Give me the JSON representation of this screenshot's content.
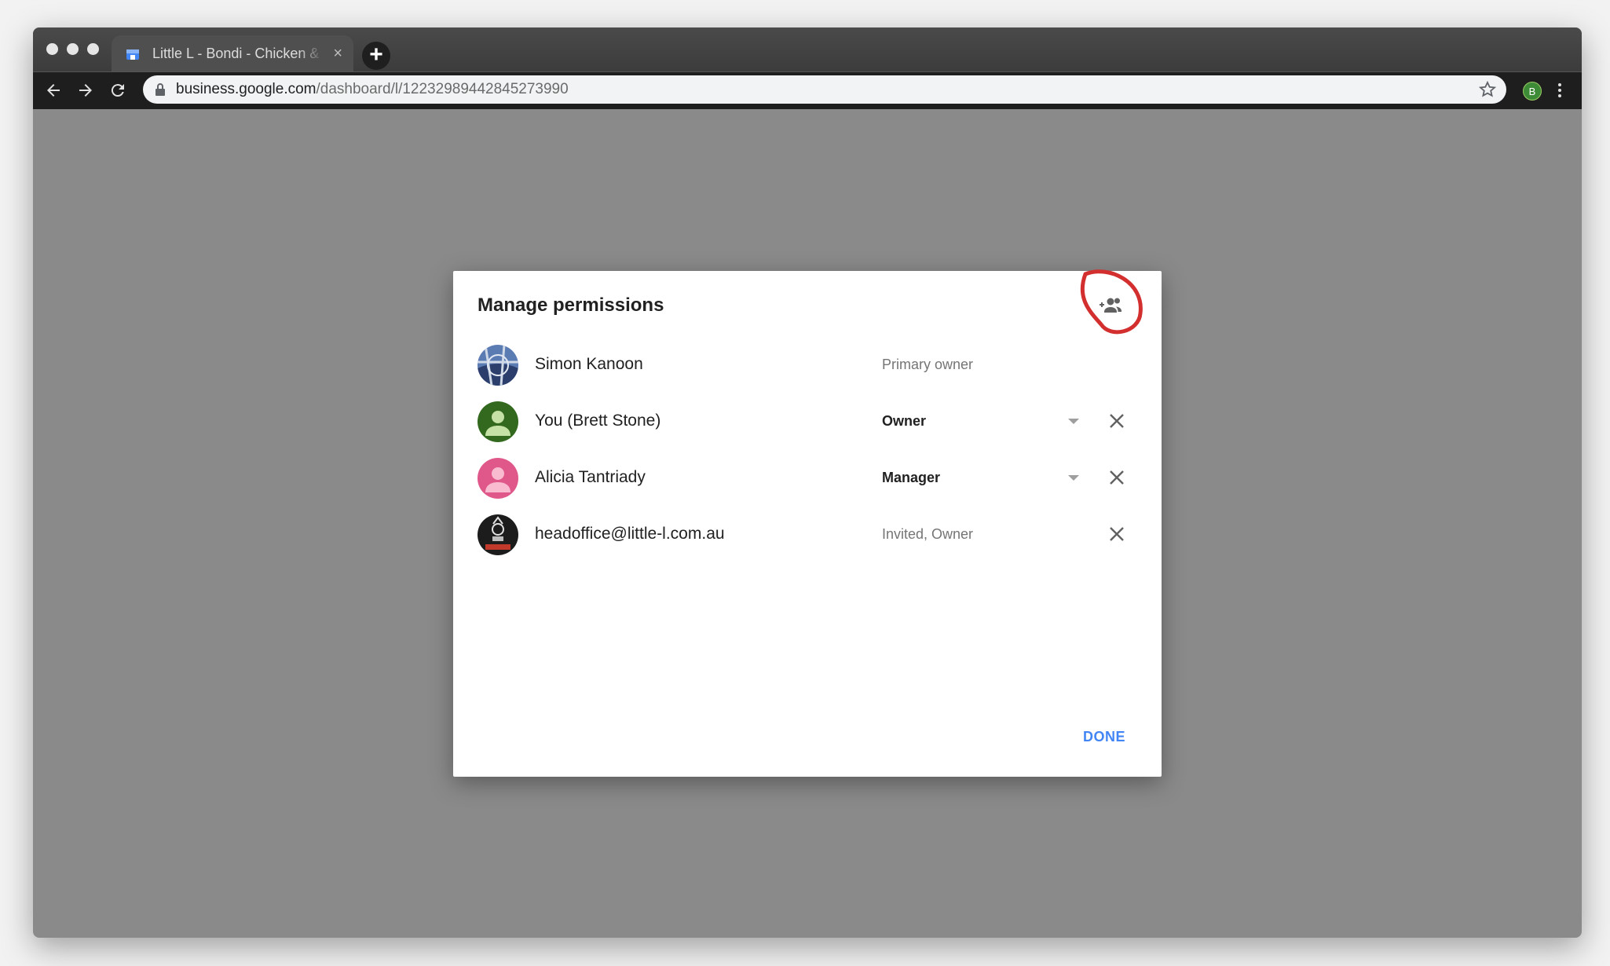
{
  "browser": {
    "tab_title": "Little L - Bondi - Chicken & Burgers",
    "tab_close": "×",
    "new_tab": "+",
    "url_host": "business.google.com",
    "url_path": "/dashboard/l/12232989442845273990",
    "profile_initial": "B",
    "accent_profile": "#3d8b37"
  },
  "dialog": {
    "title": "Manage permissions",
    "add_icon": "person-add-icon",
    "done_label": "DONE",
    "annotation_color": "#d32f2f",
    "users": [
      {
        "name": "Simon Kanoon",
        "role": "Primary owner",
        "editable": false,
        "removable": false
      },
      {
        "name": "You (Brett Stone)",
        "role": "Owner",
        "editable": true,
        "removable": true
      },
      {
        "name": "Alicia Tantriady",
        "role": "Manager",
        "editable": true,
        "removable": true
      },
      {
        "name": "headoffice@little-l.com.au",
        "role": "Invited, Owner",
        "editable": false,
        "removable": true
      }
    ]
  }
}
